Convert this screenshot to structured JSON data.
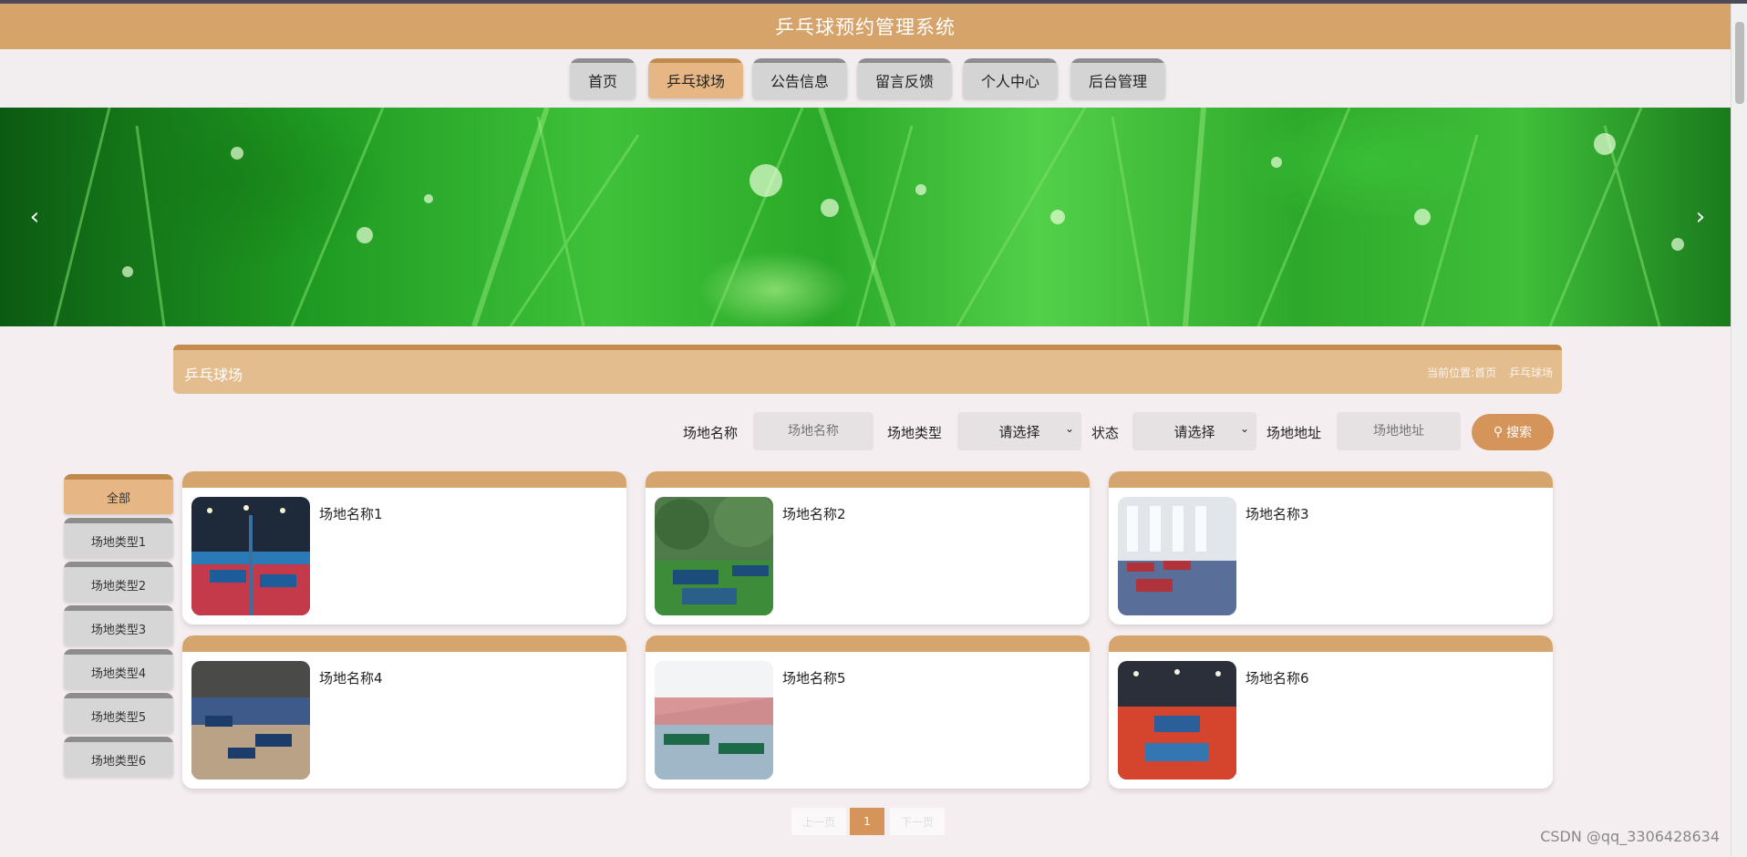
{
  "header": {
    "title": "乒乓球预约管理系统"
  },
  "nav": {
    "items": [
      {
        "label": "首页",
        "active": false
      },
      {
        "label": "乒乓球场",
        "active": true
      },
      {
        "label": "公告信息",
        "active": false
      },
      {
        "label": "留言反馈",
        "active": false
      },
      {
        "label": "个人中心",
        "active": false
      },
      {
        "label": "后台管理",
        "active": false
      }
    ]
  },
  "banner": {
    "prev_icon": "chevron-left-icon",
    "next_icon": "chevron-right-icon"
  },
  "section": {
    "title": "乒乓球场",
    "breadcrumb": [
      "当前位置:首页",
      "乒乓球场"
    ]
  },
  "search": {
    "name_label": "场地名称",
    "name_placeholder": "场地名称",
    "type_label": "场地类型",
    "type_value": "请选择",
    "status_label": "状态",
    "status_value": "请选择",
    "address_label": "场地地址",
    "address_placeholder": "场地地址",
    "button_label": "搜索",
    "button_icon": "search-icon"
  },
  "categories": [
    {
      "label": "全部",
      "active": true
    },
    {
      "label": "场地类型1",
      "active": false
    },
    {
      "label": "场地类型2",
      "active": false
    },
    {
      "label": "场地类型3",
      "active": false
    },
    {
      "label": "场地类型4",
      "active": false
    },
    {
      "label": "场地类型5",
      "active": false
    },
    {
      "label": "场地类型6",
      "active": false
    }
  ],
  "venues": [
    {
      "name": "场地名称1"
    },
    {
      "name": "场地名称2"
    },
    {
      "name": "场地名称3"
    },
    {
      "name": "场地名称4"
    },
    {
      "name": "场地名称5"
    },
    {
      "name": "场地名称6"
    }
  ],
  "pagination": {
    "prev": "上一页",
    "current": "1",
    "next": "下一页"
  },
  "watermark": "CSDN @qq_3306428634",
  "colors": {
    "accent": "#d6a36b",
    "accent_dark": "#c08a4e",
    "tab_grey": "#d4d4d4"
  }
}
